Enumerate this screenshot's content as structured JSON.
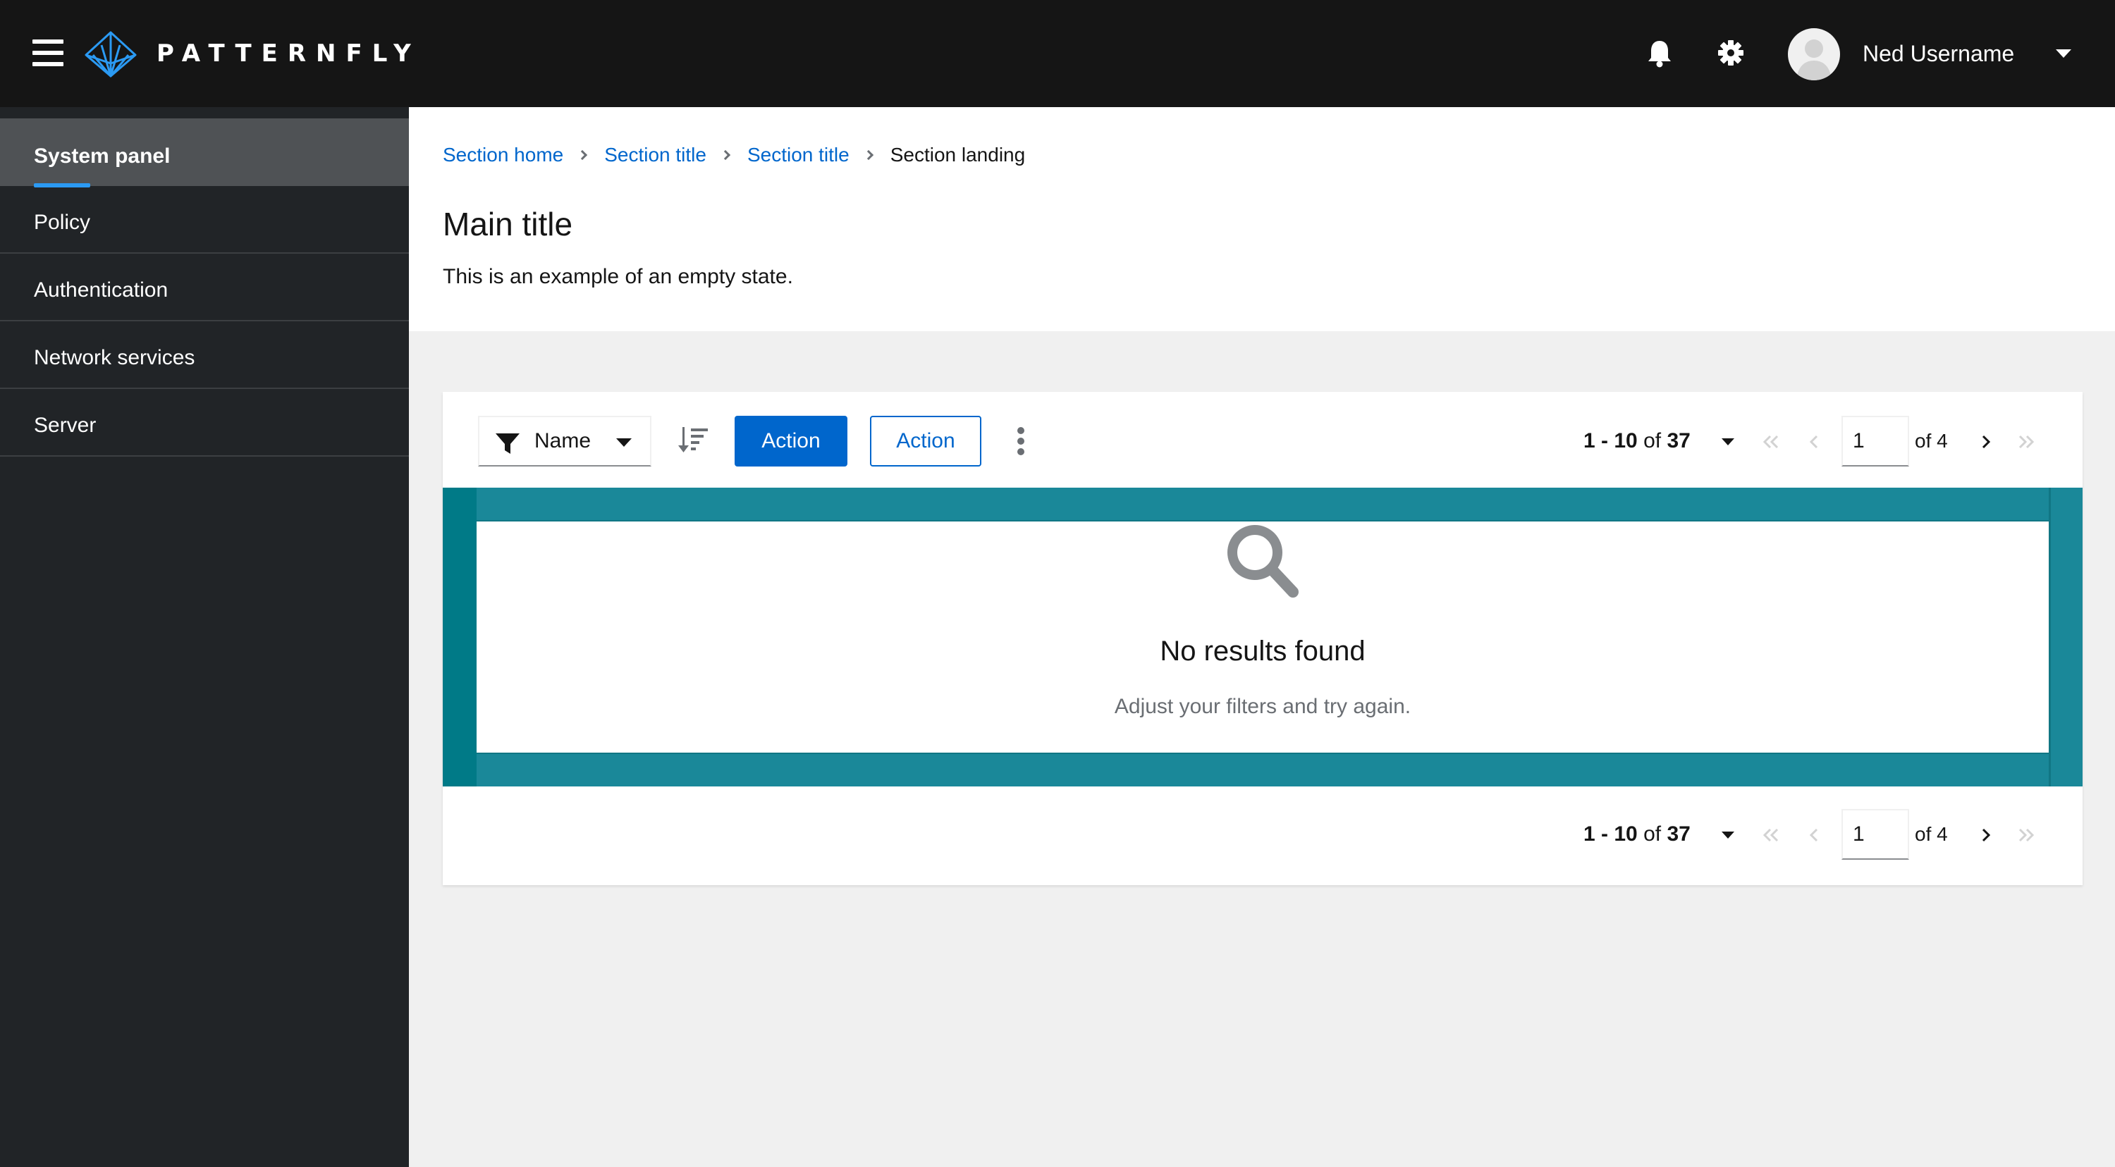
{
  "masthead": {
    "brand": "PATTERNFLY",
    "username": "Ned Username",
    "icons": [
      "menu-icon",
      "patternfly-logo",
      "bell-icon",
      "gear-icon",
      "avatar",
      "caret-down-icon"
    ]
  },
  "sidebar": {
    "items": [
      {
        "label": "System panel",
        "active": true
      },
      {
        "label": "Policy",
        "active": false
      },
      {
        "label": "Authentication",
        "active": false
      },
      {
        "label": "Network services",
        "active": false
      },
      {
        "label": "Server",
        "active": false
      }
    ]
  },
  "breadcrumb": {
    "items": [
      "Section home",
      "Section title",
      "Section title"
    ],
    "current": "Section landing"
  },
  "page": {
    "title": "Main title",
    "subtitle": "This is an example of an empty state."
  },
  "toolbar": {
    "filter_label": "Name",
    "primary_action": "Action",
    "secondary_action": "Action"
  },
  "pagination": {
    "range": "1 - 10",
    "of_label": "of",
    "total": "37",
    "page": "1",
    "page_total_label": "of 4"
  },
  "empty_state": {
    "title": "No results found",
    "body": "Adjust your filters and try again."
  },
  "colors": {
    "masthead": "#151515",
    "sidebar": "#212427",
    "link": "#0066cc",
    "primary": "#0066cc",
    "accent": "#2b9af3",
    "highlight": "#1a8899"
  }
}
